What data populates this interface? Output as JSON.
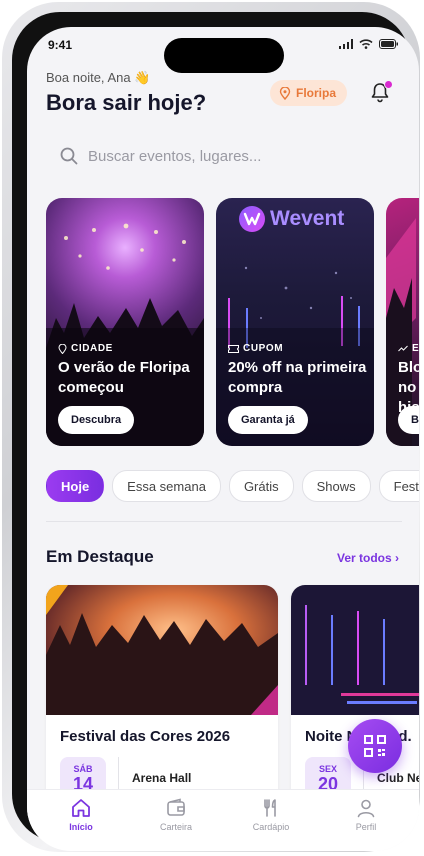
{
  "status": {
    "time": "9:41"
  },
  "header": {
    "greeting": "Boa noite, Ana 👋",
    "headline": "Bora sair hoje?",
    "location": "Floripa"
  },
  "search": {
    "placeholder": "Buscar eventos, lugares..."
  },
  "promos": [
    {
      "tag": "CIDADE",
      "title": "O verão de Floripa começou",
      "cta": "Descubra"
    },
    {
      "tag": "CUPOM",
      "title": "20% off na primeira compra",
      "cta": "Garanta já",
      "brand": "Wevent"
    },
    {
      "tag": "E",
      "title": "Blo no his",
      "cta": "Ba"
    }
  ],
  "chips": [
    "Hoje",
    "Essa semana",
    "Grátis",
    "Shows",
    "Festi"
  ],
  "featured": {
    "title": "Em Destaque",
    "see_all": "Ver todos ›",
    "events": [
      {
        "name": "Festival das Cores 2026",
        "weekday": "SÁB",
        "day": "14",
        "venue": "Arena Hall"
      },
      {
        "name": "Noite Neon Ed.",
        "weekday": "SEX",
        "day": "20",
        "venue": "Club Neon"
      }
    ]
  },
  "tabs": [
    {
      "label": "Início",
      "icon": "home-icon"
    },
    {
      "label": "Carteira",
      "icon": "wallet-icon"
    },
    {
      "label": "Cardápio",
      "icon": "cutlery-icon"
    },
    {
      "label": "Perfil",
      "icon": "user-icon"
    }
  ],
  "colors": {
    "accent": "#7b35e0",
    "location_bg": "#fde5d6",
    "location_fg": "#e8793a"
  }
}
